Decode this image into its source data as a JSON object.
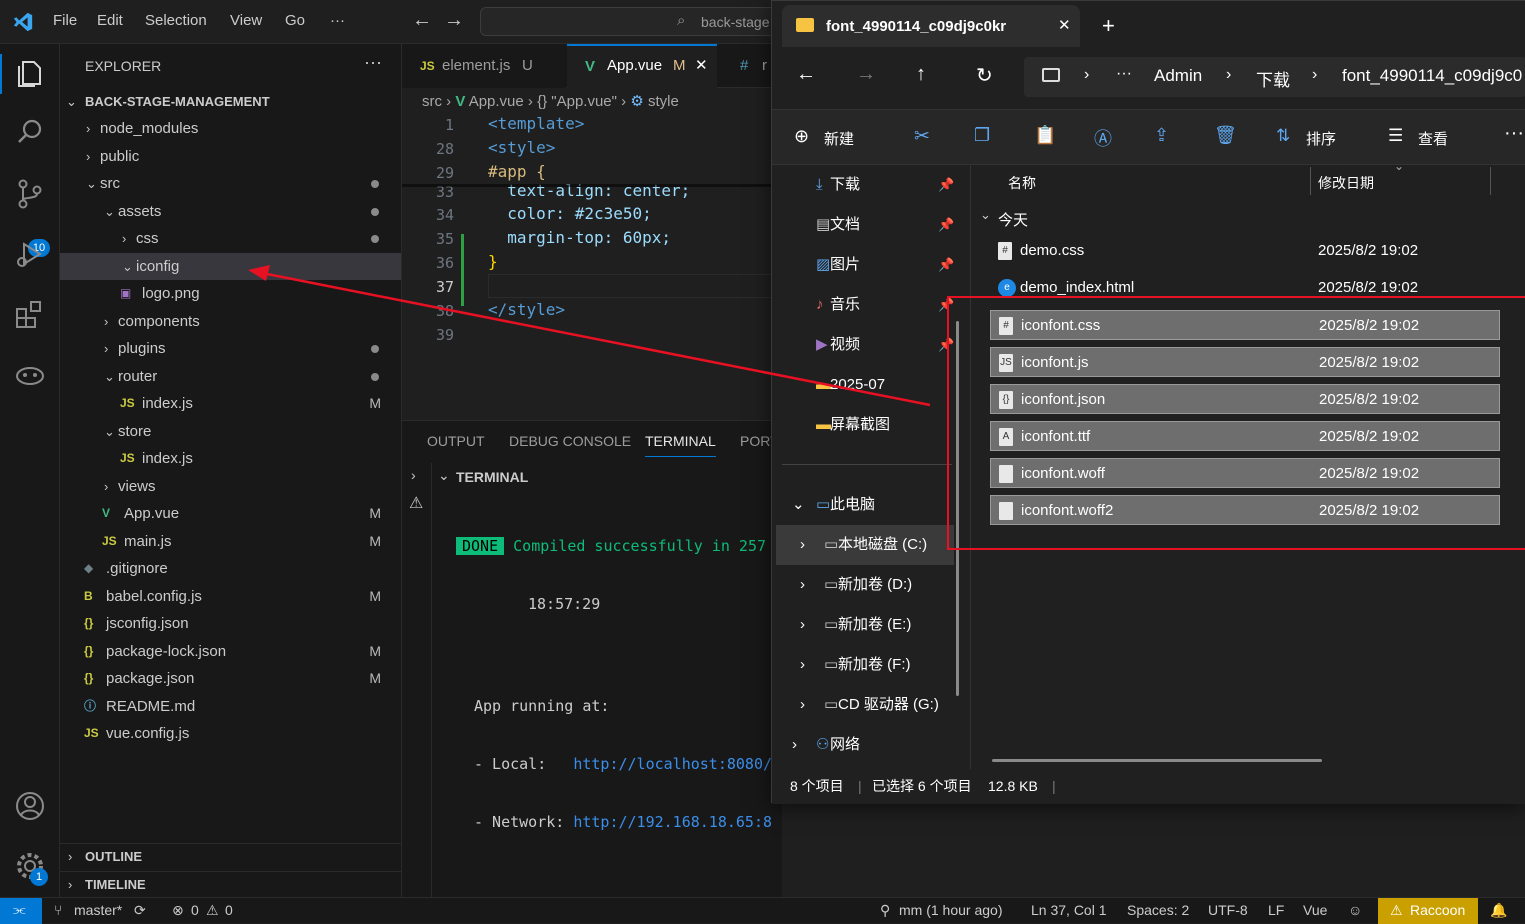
{
  "vscode": {
    "menu": [
      "File",
      "Edit",
      "Selection",
      "View",
      "Go",
      "···"
    ],
    "command_center": "back-stage",
    "activity_badges": {
      "source_control": "10",
      "settings": "1"
    },
    "sidebar": {
      "title": "EXPLORER",
      "project": "BACK-STAGE-MANAGEMENT",
      "items": [
        {
          "label": "node_modules",
          "type": "folder",
          "open": false,
          "depth": 1,
          "status": ""
        },
        {
          "label": "public",
          "type": "folder",
          "open": false,
          "depth": 1,
          "status": ""
        },
        {
          "label": "src",
          "type": "folder",
          "open": true,
          "depth": 1,
          "status": "dot"
        },
        {
          "label": "assets",
          "type": "folder",
          "open": true,
          "depth": 2,
          "status": "dot"
        },
        {
          "label": "css",
          "type": "folder",
          "open": false,
          "depth": 3,
          "status": "dot"
        },
        {
          "label": "iconfig",
          "type": "folder",
          "open": true,
          "depth": 3,
          "status": "",
          "selected": true
        },
        {
          "label": "logo.png",
          "type": "png",
          "depth": 3,
          "status": ""
        },
        {
          "label": "components",
          "type": "folder",
          "open": false,
          "depth": 2,
          "status": ""
        },
        {
          "label": "plugins",
          "type": "folder",
          "open": false,
          "depth": 2,
          "status": "dot"
        },
        {
          "label": "router",
          "type": "folder",
          "open": true,
          "depth": 2,
          "status": "dot"
        },
        {
          "label": "index.js",
          "type": "js",
          "depth": 3,
          "status": "M"
        },
        {
          "label": "store",
          "type": "folder",
          "open": true,
          "depth": 2,
          "status": ""
        },
        {
          "label": "index.js",
          "type": "js",
          "depth": 3,
          "status": ""
        },
        {
          "label": "views",
          "type": "folder",
          "open": false,
          "depth": 2,
          "status": ""
        },
        {
          "label": "App.vue",
          "type": "vue",
          "depth": 2,
          "status": "M"
        },
        {
          "label": "main.js",
          "type": "js",
          "depth": 2,
          "status": "M"
        },
        {
          "label": ".gitignore",
          "type": "git",
          "depth": 1,
          "status": ""
        },
        {
          "label": "babel.config.js",
          "type": "babel",
          "depth": 1,
          "status": "M"
        },
        {
          "label": "jsconfig.json",
          "type": "json",
          "depth": 1,
          "status": ""
        },
        {
          "label": "package-lock.json",
          "type": "json",
          "depth": 1,
          "status": "M"
        },
        {
          "label": "package.json",
          "type": "json",
          "depth": 1,
          "status": "M"
        },
        {
          "label": "README.md",
          "type": "info",
          "depth": 1,
          "status": ""
        },
        {
          "label": "vue.config.js",
          "type": "js",
          "depth": 1,
          "status": ""
        }
      ],
      "outline": "OUTLINE",
      "timeline": "TIMELINE"
    },
    "tabs": [
      {
        "label": "element.js",
        "icon": "JS",
        "status": "U",
        "active": false
      },
      {
        "label": "App.vue",
        "icon": "V",
        "status": "M",
        "active": true
      },
      {
        "label": "r",
        "icon": "#",
        "status": "",
        "active": false
      }
    ],
    "breadcrumb": [
      "src",
      "App.vue",
      "{} \"App.vue\"",
      "style"
    ],
    "code_lines": [
      {
        "n": "1",
        "text": "<template>"
      },
      {
        "n": "28",
        "text": "<style>"
      },
      {
        "n": "29",
        "text": "#app {"
      },
      {
        "n": "33",
        "text": "  text-align: center;"
      },
      {
        "n": "34",
        "text": "  color: #2c3e50;"
      },
      {
        "n": "35",
        "text": "  margin-top: 60px;"
      },
      {
        "n": "36",
        "text": "}"
      },
      {
        "n": "37",
        "text": ""
      },
      {
        "n": "38",
        "text": "</style>"
      },
      {
        "n": "39",
        "text": ""
      }
    ],
    "panel_tabs": [
      "OUTPUT",
      "DEBUG CONSOLE",
      "TERMINAL",
      "PORT"
    ],
    "terminal": {
      "header": "TERMINAL",
      "done": "DONE",
      "compiled": "Compiled successfully in 257",
      "time": "18:57:29",
      "running": "App running at:",
      "local_label": "- Local:   ",
      "local_url": "http://localhost:8080/",
      "network_label": "- Network: ",
      "network_url": "http://192.168.18.65:8"
    },
    "status": {
      "branch": "master*",
      "errors": "0",
      "warnings": "0",
      "blame": "mm (1 hour ago)",
      "position": "Ln 37, Col 1",
      "spaces": "Spaces: 2",
      "encoding": "UTF-8",
      "eol": "LF",
      "language": "Vue",
      "raccoon": "Raccoon"
    }
  },
  "explorer_window": {
    "tab_title": "font_4990114_c09dj9c0kr",
    "address": [
      "Admin",
      "下载",
      "font_4990114_c09dj9c0"
    ],
    "toolbar": {
      "new": "新建",
      "sort": "排序",
      "view": "查看"
    },
    "nav": [
      "下载",
      "文档",
      "图片",
      "音乐",
      "视频",
      "2025-07",
      "屏幕截图",
      "此电脑",
      "本地磁盘 (C:)",
      "新加卷 (D:)",
      "新加卷 (E:)",
      "新加卷 (F:)",
      "CD 驱动器 (G:)",
      "网络"
    ],
    "columns": {
      "name": "名称",
      "date": "修改日期"
    },
    "group": "今天",
    "files": [
      {
        "name": "demo.css",
        "date": "2025/8/2 19:02",
        "selected": false,
        "icon": "#"
      },
      {
        "name": "demo_index.html",
        "date": "2025/8/2 19:02",
        "selected": false,
        "icon": "e"
      },
      {
        "name": "iconfont.css",
        "date": "2025/8/2 19:02",
        "selected": true,
        "icon": "#"
      },
      {
        "name": "iconfont.js",
        "date": "2025/8/2 19:02",
        "selected": true,
        "icon": "JS"
      },
      {
        "name": "iconfont.json",
        "date": "2025/8/2 19:02",
        "selected": true,
        "icon": "{}"
      },
      {
        "name": "iconfont.ttf",
        "date": "2025/8/2 19:02",
        "selected": true,
        "icon": "A"
      },
      {
        "name": "iconfont.woff",
        "date": "2025/8/2 19:02",
        "selected": true,
        "icon": ""
      },
      {
        "name": "iconfont.woff2",
        "date": "2025/8/2 19:02",
        "selected": true,
        "icon": ""
      }
    ],
    "statusbar": {
      "count": "8 个项目",
      "selected": "已选择 6 个项目",
      "size": "12.8 KB"
    }
  },
  "colors": {
    "accent": "#0078d4",
    "annotation": "#e81123",
    "vue": "#42b883",
    "done": "#0dbc79"
  }
}
